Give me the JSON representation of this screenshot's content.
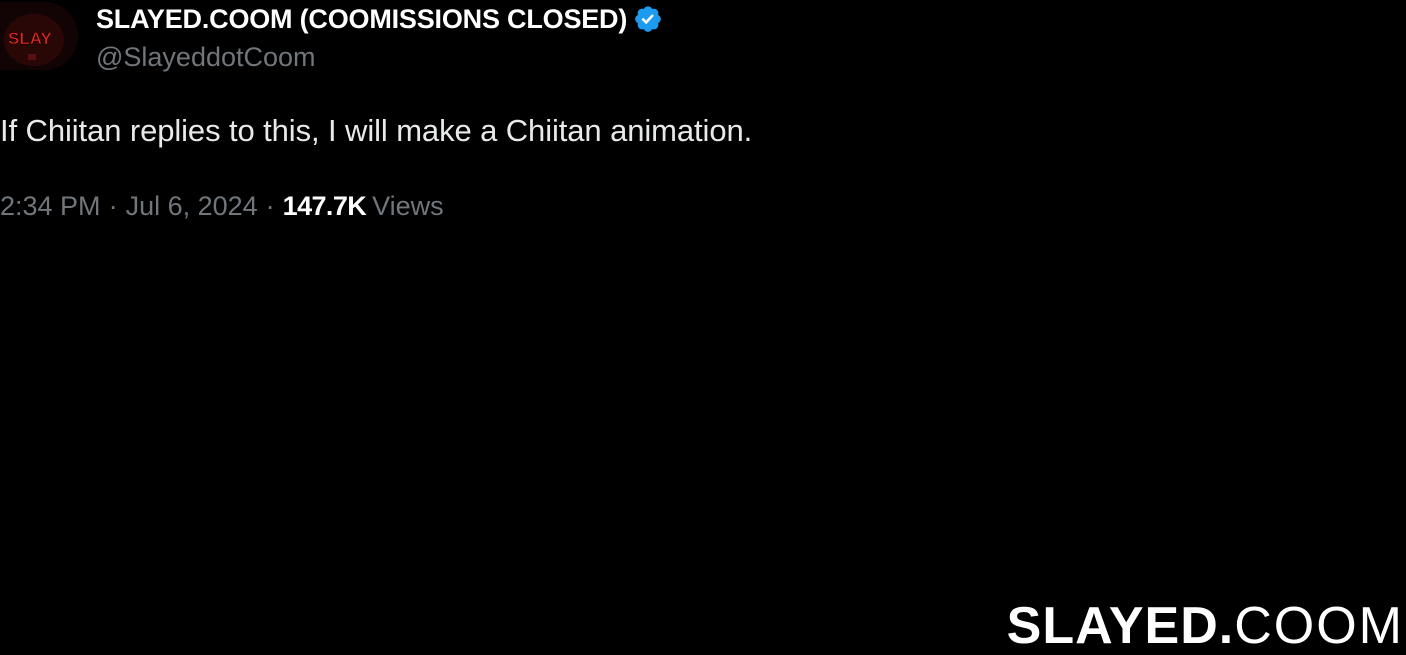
{
  "tweet": {
    "author": {
      "display_name": "SLAYED.COOM (COOMISSIONS CLOSED)",
      "handle": "@SlayeddotCoom",
      "avatar_text": "SLAY",
      "verified": true,
      "verified_color": "#1d9bf0"
    },
    "text": "If Chiitan replies to this, I will make a Chiitan animation.",
    "time": "2:34 PM",
    "separator": "·",
    "date": "Jul 6, 2024",
    "views_count": "147.7K",
    "views_label": "Views"
  },
  "watermark": {
    "bold_part": "SLAYED.",
    "light_part": "COOM"
  },
  "colors": {
    "background": "#000000",
    "primary_text": "#e7e9ea",
    "secondary_text": "#71767b",
    "accent_red": "#e8241c"
  }
}
